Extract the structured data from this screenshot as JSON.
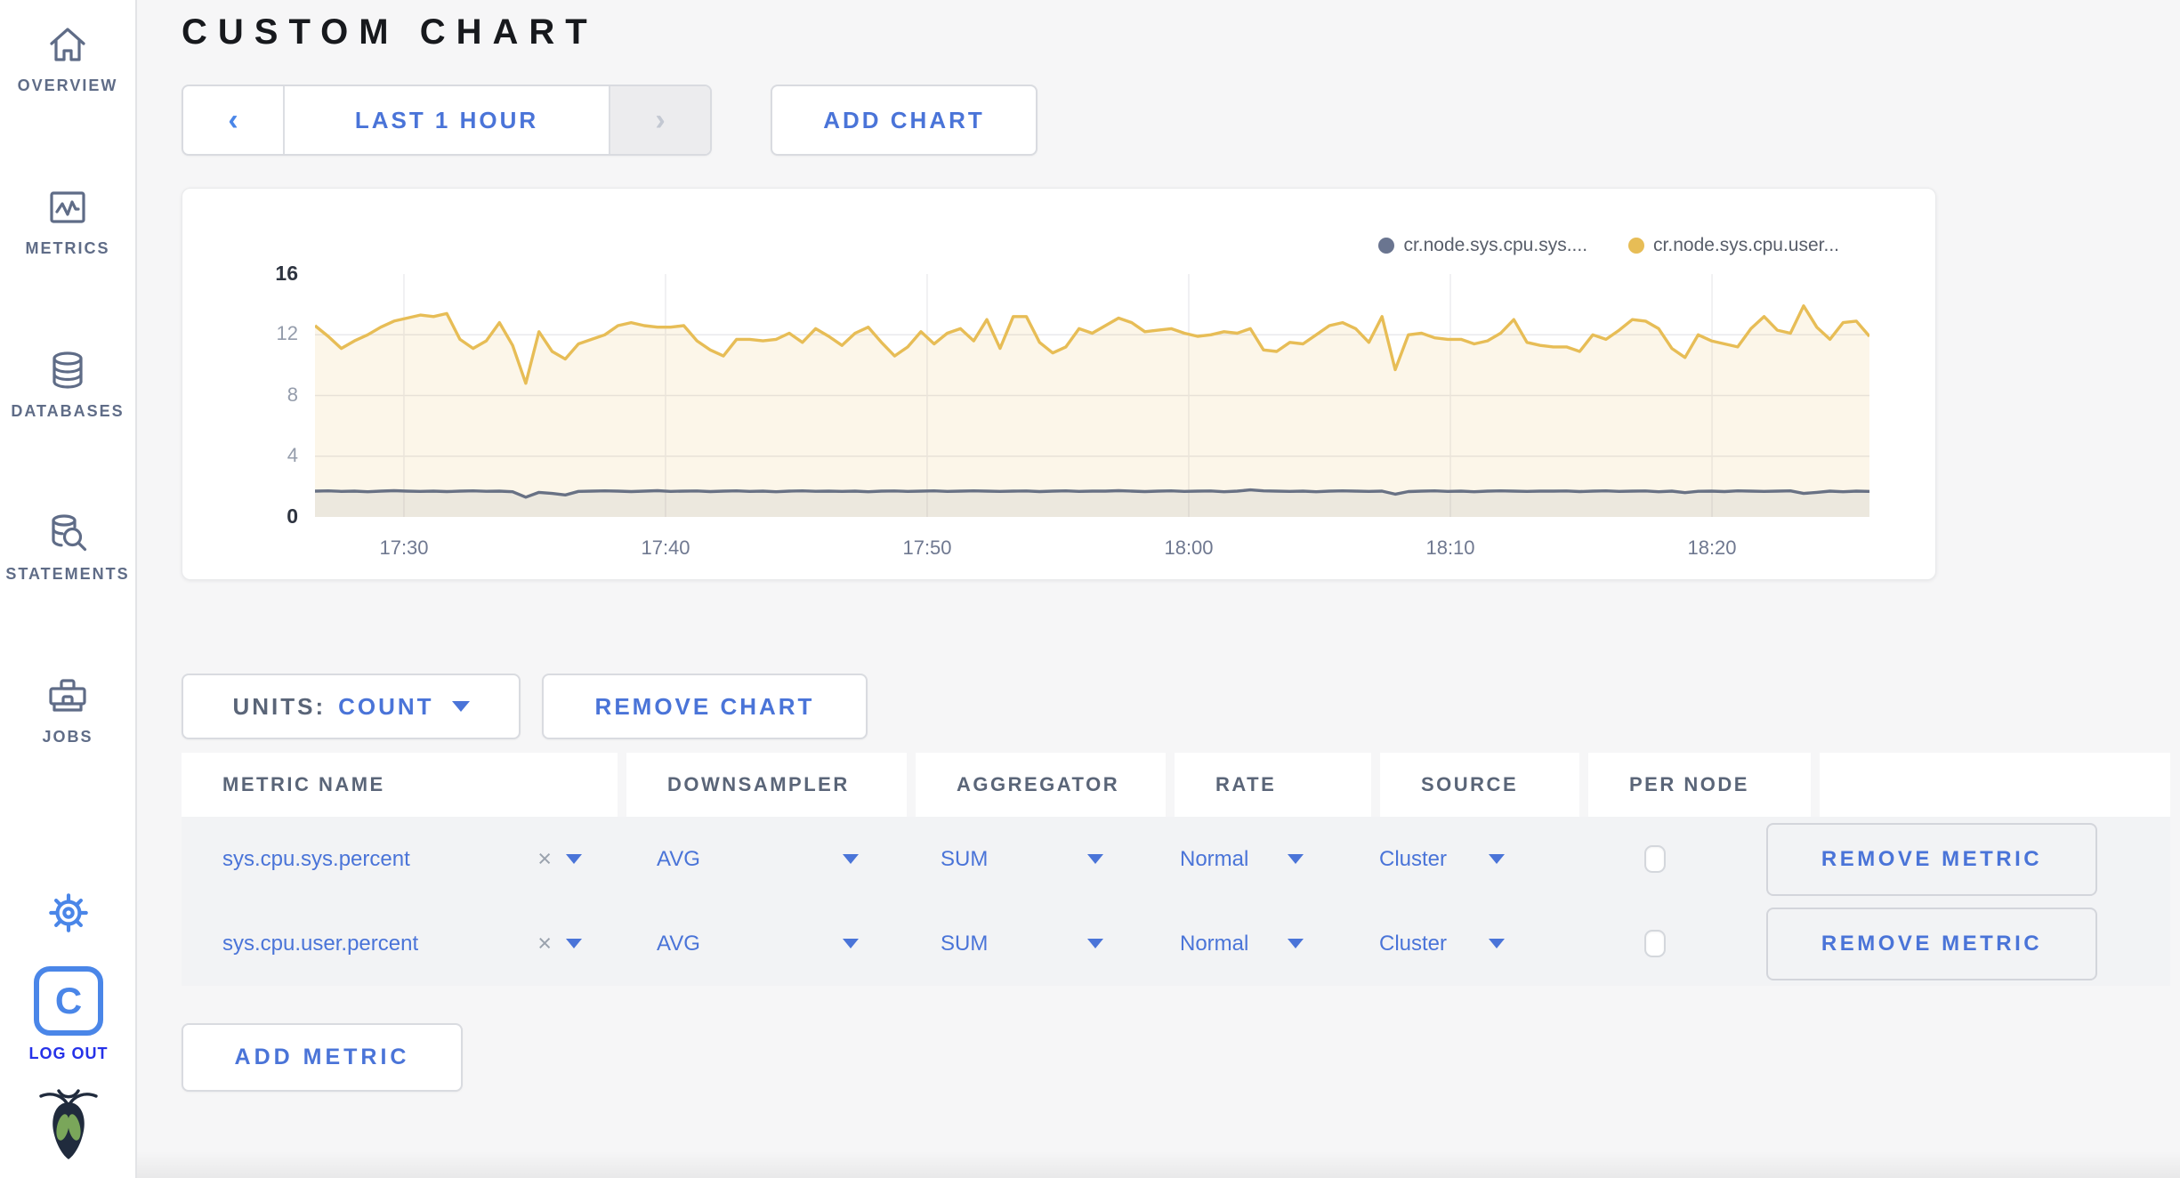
{
  "colors": {
    "accent_blue": "#4a74d8",
    "icon_blue": "#4a86e8",
    "logout_blue": "#2531e8",
    "slate": "#5f6c87",
    "series_yellow": "#e7bd56",
    "series_gray": "#687184"
  },
  "sidebar": {
    "items": [
      {
        "label": "OVERVIEW"
      },
      {
        "label": "METRICS"
      },
      {
        "label": "DATABASES"
      },
      {
        "label": "STATEMENTS"
      },
      {
        "label": "JOBS"
      }
    ],
    "logout_label": "LOG OUT",
    "logo_letter": "C"
  },
  "header": {
    "title": "CUSTOM CHART"
  },
  "controls": {
    "prev_arrow": "‹",
    "time_range_label": "LAST 1 HOUR",
    "next_arrow": "›",
    "add_chart_label": "ADD CHART"
  },
  "chart_data": {
    "type": "line",
    "title": "",
    "legend_position": "top-right",
    "grid": true,
    "x_range": [
      "17:26:30",
      "18:25:30"
    ],
    "x_interval_sec": 30,
    "xtick_labels": [
      "17:30",
      "17:40",
      "17:50",
      "18:00",
      "18:10",
      "18:20"
    ],
    "xtick_fracs": [
      0.0572,
      0.2255,
      0.3938,
      0.5621,
      0.7304,
      0.8987
    ],
    "ytick_labels": [
      "16",
      "12",
      "8",
      "4",
      "0"
    ],
    "ylim": [
      0,
      16
    ],
    "grid_yticks": [
      4,
      8,
      12
    ],
    "series": [
      {
        "name": "cr.node.sys.cpu.sys....",
        "color": "#687184",
        "dot_color": "#6a7590",
        "fill": "rgba(100,110,132,0.10)",
        "values": [
          1.7,
          1.72,
          1.68,
          1.7,
          1.66,
          1.7,
          1.73,
          1.7,
          1.68,
          1.7,
          1.67,
          1.7,
          1.72,
          1.69,
          1.7,
          1.66,
          1.3,
          1.62,
          1.55,
          1.45,
          1.68,
          1.7,
          1.72,
          1.7,
          1.67,
          1.7,
          1.73,
          1.68,
          1.7,
          1.71,
          1.67,
          1.7,
          1.72,
          1.68,
          1.7,
          1.66,
          1.7,
          1.72,
          1.69,
          1.7,
          1.68,
          1.7,
          1.66,
          1.7,
          1.71,
          1.68,
          1.7,
          1.72,
          1.68,
          1.7,
          1.72,
          1.7,
          1.68,
          1.7,
          1.71,
          1.67,
          1.7,
          1.72,
          1.68,
          1.7,
          1.7,
          1.73,
          1.7,
          1.67,
          1.7,
          1.72,
          1.68,
          1.7,
          1.71,
          1.66,
          1.7,
          1.78,
          1.72,
          1.7,
          1.68,
          1.7,
          1.66,
          1.7,
          1.72,
          1.7,
          1.68,
          1.7,
          1.5,
          1.67,
          1.7,
          1.72,
          1.68,
          1.7,
          1.66,
          1.7,
          1.72,
          1.7,
          1.68,
          1.7,
          1.7,
          1.71,
          1.67,
          1.7,
          1.72,
          1.68,
          1.7,
          1.71,
          1.66,
          1.7,
          1.6,
          1.69,
          1.7,
          1.67,
          1.72,
          1.7,
          1.68,
          1.7,
          1.72,
          1.55,
          1.62,
          1.7,
          1.66,
          1.7,
          1.68
        ]
      },
      {
        "name": "cr.node.sys.cpu.user...",
        "color": "#e7bd56",
        "dot_color": "#e7bd56",
        "fill": "rgba(231,189,86,0.13)",
        "values": [
          12.6,
          11.9,
          11.1,
          11.6,
          12.0,
          12.5,
          12.9,
          13.1,
          13.3,
          13.2,
          13.4,
          11.7,
          11.1,
          11.6,
          12.8,
          11.3,
          8.8,
          12.2,
          10.9,
          10.4,
          11.4,
          11.7,
          12.0,
          12.6,
          12.8,
          12.6,
          12.5,
          12.5,
          12.6,
          11.6,
          11.0,
          10.6,
          11.7,
          11.7,
          11.6,
          11.7,
          12.1,
          11.5,
          12.4,
          11.9,
          11.3,
          12.1,
          12.5,
          11.5,
          10.6,
          11.2,
          12.2,
          11.4,
          12.1,
          12.4,
          11.6,
          13.0,
          11.1,
          13.2,
          13.2,
          11.5,
          10.8,
          11.2,
          12.4,
          12.1,
          12.6,
          13.1,
          12.8,
          12.2,
          12.3,
          12.4,
          12.1,
          11.9,
          12.0,
          12.2,
          12.1,
          12.4,
          11.0,
          10.9,
          11.5,
          11.4,
          12.0,
          12.6,
          12.8,
          12.4,
          11.5,
          13.2,
          9.7,
          12.0,
          12.1,
          11.8,
          11.7,
          11.7,
          11.4,
          11.6,
          12.1,
          13.0,
          11.5,
          11.3,
          11.2,
          11.2,
          10.9,
          12.0,
          11.7,
          12.3,
          13.0,
          12.9,
          12.4,
          11.1,
          10.5,
          12.0,
          11.6,
          11.4,
          11.2,
          12.4,
          13.2,
          12.3,
          12.1,
          13.9,
          12.5,
          11.7,
          12.8,
          12.9,
          11.9
        ]
      }
    ]
  },
  "units": {
    "label": "UNITS:",
    "value": "COUNT"
  },
  "remove_chart_label": "REMOVE CHART",
  "table": {
    "headers": [
      "METRIC NAME",
      "DOWNSAMPLER",
      "AGGREGATOR",
      "RATE",
      "SOURCE",
      "PER NODE",
      ""
    ],
    "rows": [
      {
        "name": "sys.cpu.sys.percent",
        "clear": "×",
        "downsampler": "AVG",
        "aggregator": "SUM",
        "rate": "Normal",
        "source": "Cluster",
        "per_node_checked": false,
        "remove_label": "REMOVE METRIC"
      },
      {
        "name": "sys.cpu.user.percent",
        "clear": "×",
        "downsampler": "AVG",
        "aggregator": "SUM",
        "rate": "Normal",
        "source": "Cluster",
        "per_node_checked": false,
        "remove_label": "REMOVE METRIC"
      }
    ]
  },
  "add_metric_label": "ADD METRIC"
}
